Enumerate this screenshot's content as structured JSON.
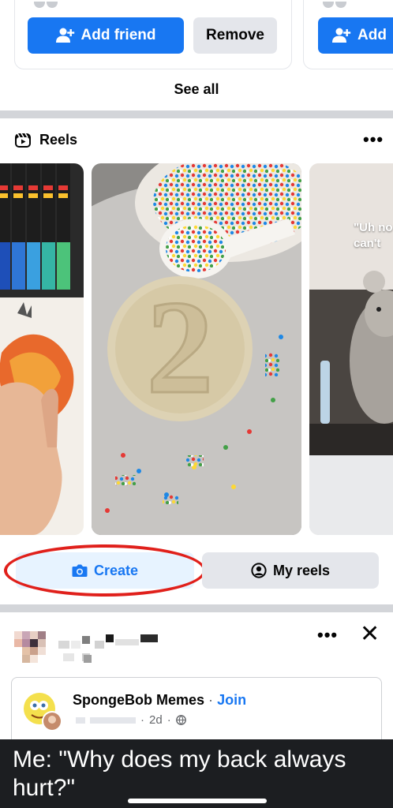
{
  "friend_suggestions": {
    "cards": [
      {
        "add_label": "Add friend",
        "remove_label": "Remove"
      },
      {
        "add_label": "Add"
      }
    ],
    "see_all_label": "See all"
  },
  "reels": {
    "section_title": "Reels",
    "items": [
      {
        "description": "Paint markers and drawing of a bird"
      },
      {
        "description": "Number 2 cookie with sprinkles"
      },
      {
        "caption_line1": "\"Uh no",
        "caption_line2": "can't"
      }
    ],
    "create_label": "Create",
    "my_reels_label": "My reels"
  },
  "post": {
    "group_name": "SpongeBob Memes",
    "separator": "·",
    "join_label": "Join",
    "time": "2d",
    "meme_text": "Me: \"Why does my back always hurt?\""
  },
  "colors": {
    "accent": "#1877f2",
    "accent_light": "#e7f3ff",
    "highlight": "#e0201b",
    "divider": "#d3d5d9"
  },
  "icons": [
    "add-person-icon",
    "reels-icon",
    "more-dots-icon",
    "camera-icon",
    "profile-circle-icon",
    "close-icon",
    "globe-icon"
  ]
}
